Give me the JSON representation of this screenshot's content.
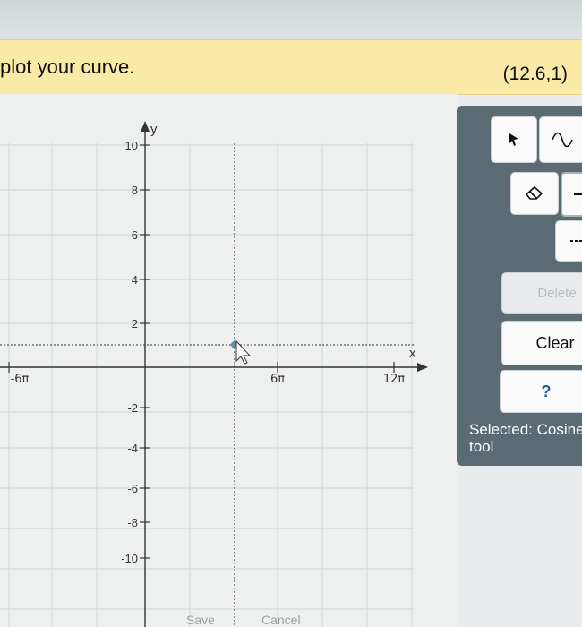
{
  "header": {
    "instruction": "plot your curve.",
    "coordinates": "(12.6,1)"
  },
  "graph": {
    "y_axis_label": "y",
    "x_axis_label": "x",
    "y_ticks": [
      "10",
      "8",
      "6",
      "4",
      "2",
      "-2",
      "-4",
      "-6",
      "-8",
      "-10"
    ],
    "x_ticks": [
      "-6π",
      "6π",
      "12π"
    ]
  },
  "tools": {
    "pointer_icon": "arrow-pointer-icon",
    "cosine_icon": "cosine-wave-icon",
    "eraser_icon": "eraser-icon",
    "line_icon": "line-segment-icon",
    "dashed_icon": "dashed-line-icon",
    "delete_label": "Delete",
    "clear_label": "Clear",
    "help_label": "?",
    "selected_text": "Selected: Cosine tool"
  },
  "footer": {
    "save_label": "Save",
    "cancel_label": "Cancel"
  }
}
